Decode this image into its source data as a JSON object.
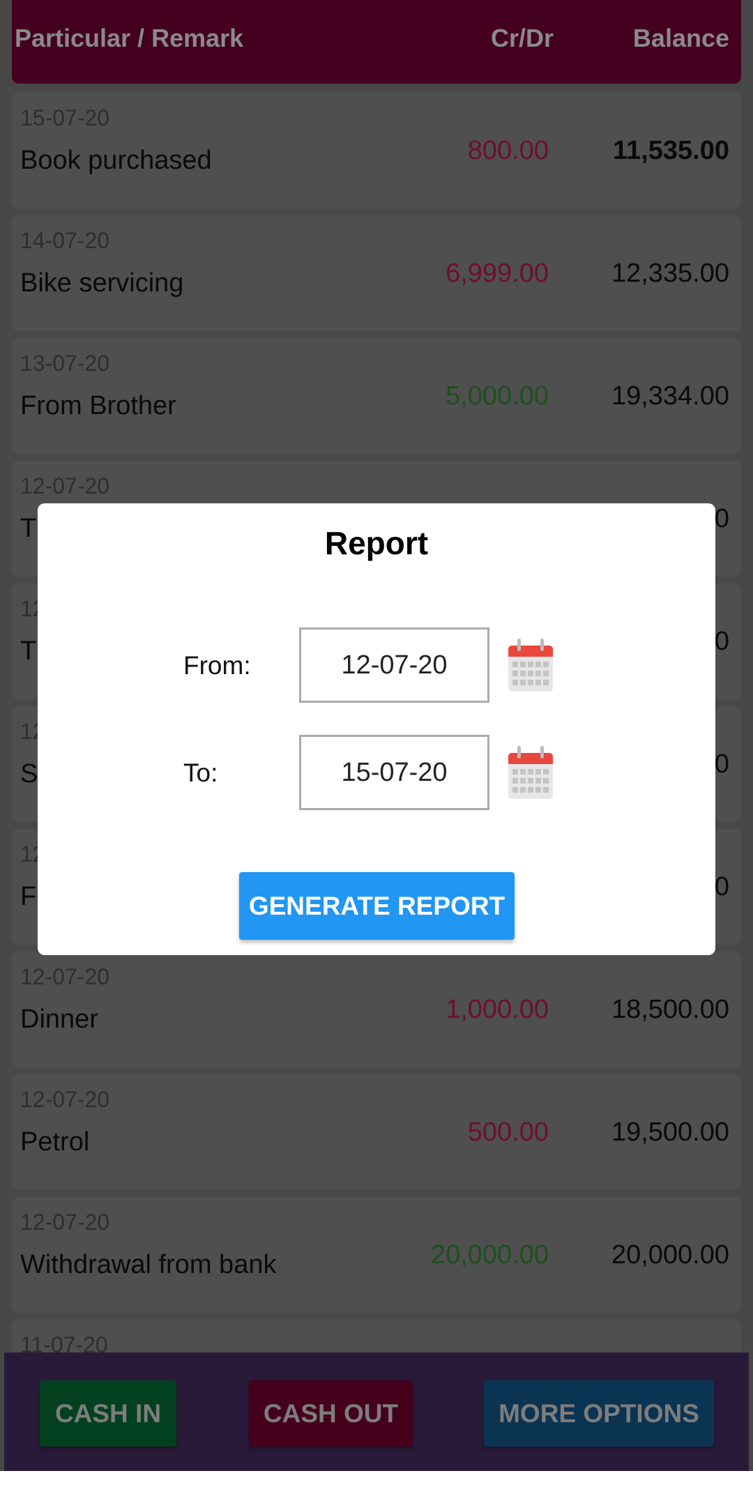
{
  "header": {
    "particular": "Particular / Remark",
    "crdr": "Cr/Dr",
    "balance": "Balance"
  },
  "rows": [
    {
      "date": "15-07-20",
      "title": "Book purchased",
      "amount": "800.00",
      "type": "debit",
      "balance": "11,535.00"
    },
    {
      "date": "14-07-20",
      "title": "Bike servicing",
      "amount": "6,999.00",
      "type": "debit",
      "balance": "12,335.00"
    },
    {
      "date": "13-07-20",
      "title": "From Brother",
      "amount": "5,000.00",
      "type": "credit",
      "balance": "19,334.00"
    },
    {
      "date": "12-07-20",
      "title": "T",
      "amount": "",
      "type": "",
      "balance": "0"
    },
    {
      "date": "12",
      "title": "T",
      "amount": "",
      "type": "",
      "balance": "0"
    },
    {
      "date": "12",
      "title": "S",
      "amount": "",
      "type": "",
      "balance": "0"
    },
    {
      "date": "12",
      "title": "F",
      "amount": "",
      "type": "",
      "balance": "0"
    },
    {
      "date": "12-07-20",
      "title": "Dinner",
      "amount": "1,000.00",
      "type": "debit",
      "balance": "18,500.00"
    },
    {
      "date": "12-07-20",
      "title": "Petrol",
      "amount": "500.00",
      "type": "debit",
      "balance": "19,500.00"
    },
    {
      "date": "12-07-20",
      "title": "Withdrawal from bank",
      "amount": "20,000.00",
      "type": "credit",
      "balance": "20,000.00"
    },
    {
      "date": "11-07-20",
      "title": "",
      "amount": "",
      "type": "",
      "balance": ""
    }
  ],
  "bottom": {
    "cash_in": "CASH IN",
    "cash_out": "CASH OUT",
    "more_options": "MORE OPTIONS"
  },
  "dialog": {
    "title": "Report",
    "from_label": "From:",
    "from_value": "12-07-20",
    "to_label": "To:",
    "to_value": "15-07-20",
    "generate": "GENERATE REPORT"
  },
  "colors": {
    "accent": "#2196f3",
    "header": "#c8005e",
    "debit": "#b0184a",
    "credit": "#2e7d32"
  },
  "icons": {
    "calendar": "calendar-icon"
  }
}
